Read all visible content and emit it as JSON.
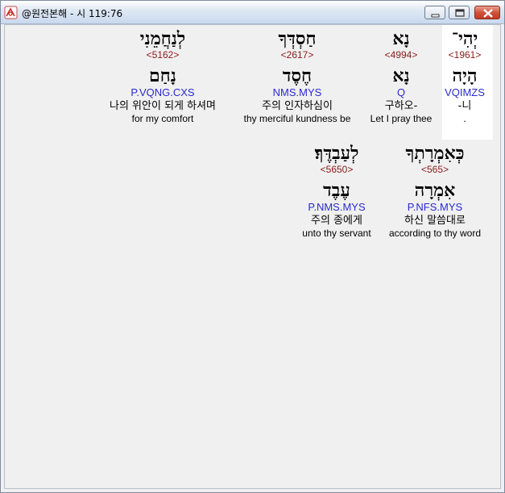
{
  "window": {
    "title": "@원전본해 - 시 119:76"
  },
  "colors": {
    "strong_number": "#8b1a1a",
    "morphology": "#2a2ad0",
    "highlight_background": "#ffffff"
  },
  "rows": [
    {
      "words": [
        {
          "text": "יְהִי־",
          "strong": "<1961>",
          "lemma": "הָיָה",
          "morph": "VQIMZS",
          "korean": "-니",
          "english": "."
        },
        {
          "text": "נָא",
          "strong": "<4994>",
          "lemma": "נָא",
          "morph": "Q",
          "korean": "구하오-",
          "english": "Let I pray thee"
        },
        {
          "text": "חַסְדְּךָ",
          "strong": "<2617>",
          "lemma": "חֶסֶד",
          "morph": "NMS.MYS",
          "korean": "주의 인자하심이",
          "english": "thy merciful kundness be"
        },
        {
          "text": "לְנַחֲמֵנִי",
          "strong": "<5162>",
          "lemma": "נָחַם",
          "morph": "P.VQNG.CXS",
          "korean": "나의 위안이 되게 하셔며",
          "english": "for my comfort"
        }
      ]
    },
    {
      "words": [
        {
          "text": "כְּאִמְרָתְךָ",
          "strong": "<565>",
          "lemma": "אִמְרָה",
          "morph": "P.NFS.MYS",
          "korean": "하신 말씀대로",
          "english": "according to thy word"
        },
        {
          "text": "לְעַבְדֶּךָ׃",
          "strong": "<5650>",
          "lemma": "עֶבֶד",
          "morph": "P.NMS.MYS",
          "korean": "주의 종에게",
          "english": "unto thy servant"
        }
      ]
    }
  ]
}
